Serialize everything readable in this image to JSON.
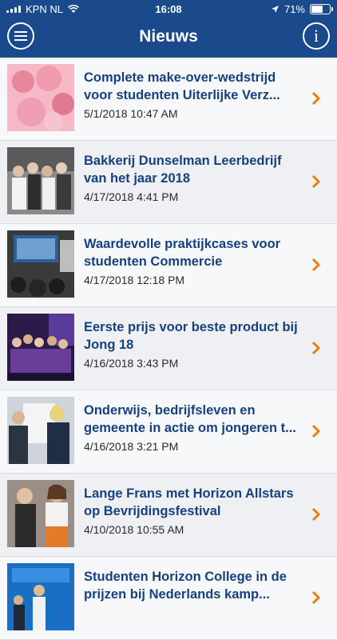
{
  "status_bar": {
    "carrier": "KPN NL",
    "time": "16:08",
    "battery_percent": "71%",
    "battery_level": 0.71
  },
  "header": {
    "title": "Nieuws",
    "menu_icon": "hamburger-menu-icon",
    "info_icon": "info-icon",
    "info_glyph": "i",
    "background": "#1a4a8c"
  },
  "colors": {
    "headline": "#17407e",
    "chevron": "#f07d00"
  },
  "news": [
    {
      "title": "Complete make-over-wedstrijd voor studenten Uiterlijke Verz...",
      "date": "5/1/2018 10:47 AM"
    },
    {
      "title": "Bakkerij Dunselman Leerbedrijf van het jaar 2018",
      "date": "4/17/2018 4:41 PM"
    },
    {
      "title": "Waardevolle praktijkcases voor studenten Commercie",
      "date": "4/17/2018 12:18 PM"
    },
    {
      "title": "Eerste prijs voor beste product bij Jong 18",
      "date": "4/16/2018 3:43 PM"
    },
    {
      "title": "Onderwijs, bedrijfsleven en gemeente in actie om jongeren t...",
      "date": "4/16/2018 3:21 PM"
    },
    {
      "title": "Lange Frans met Horizon Allstars op Bevrijdingsfestival",
      "date": "4/10/2018 10:55 AM"
    },
    {
      "title": "Studenten Horizon College in de prijzen bij Nederlands kamp...",
      "date": ""
    }
  ]
}
